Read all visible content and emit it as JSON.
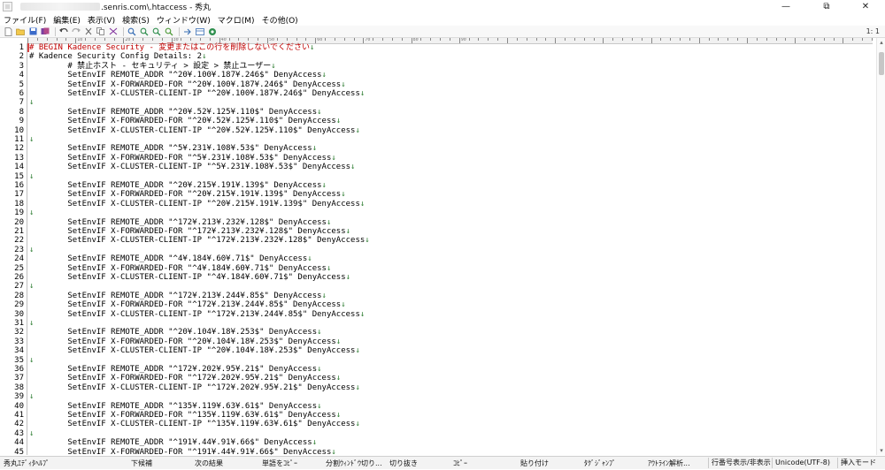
{
  "window": {
    "title_path": ".senris.com\\.htaccess - 秀丸",
    "controls": {
      "minimize": "—",
      "restore": "⧉",
      "close": "✕"
    }
  },
  "menu": [
    "ファイル(F)",
    "編集(E)",
    "表示(V)",
    "検索(S)",
    "ウィンドウ(W)",
    "マクロ(M)",
    "その他(O)"
  ],
  "toolbar": {
    "buttons": [
      "new-file-icon",
      "open-icon",
      "save-icon",
      "save-all-icon",
      "undo-icon",
      "redo-icon",
      "cut-icon",
      "copy-icon",
      "paste-icon",
      "search-icon",
      "find-next-icon",
      "find-prev-icon",
      "grep-icon",
      "jump-icon",
      "macro-icon",
      "record-icon"
    ],
    "zoom": "1: 1"
  },
  "ruler": {
    "labels": [
      "10",
      "20",
      "30",
      "40",
      "50",
      "60",
      "70",
      "80",
      "90"
    ]
  },
  "editor": {
    "eol_mark": "↓",
    "lines": [
      {
        "n": "1",
        "t": "# BEGIN Kadence Security - 変更またはこの行を削除しないでください",
        "kind": "comment-red"
      },
      {
        "n": "2",
        "t": "# Kadence Security Config Details: 2",
        "kind": "comment"
      },
      {
        "n": "3",
        "t": "        # 禁止ホスト - セキュリティ > 設定 > 禁止ユーザー",
        "kind": "comment"
      },
      {
        "n": "4",
        "t": "        SetEnvIF REMOTE_ADDR \"^20¥.100¥.187¥.246$\" DenyAccess",
        "kind": "code"
      },
      {
        "n": "5",
        "t": "        SetEnvIF X-FORWARDED-FOR \"^20¥.100¥.187¥.246$\" DenyAccess",
        "kind": "code"
      },
      {
        "n": "6",
        "t": "        SetEnvIF X-CLUSTER-CLIENT-IP \"^20¥.100¥.187¥.246$\" DenyAccess",
        "kind": "code"
      },
      {
        "n": "7",
        "t": "",
        "kind": "code"
      },
      {
        "n": "8",
        "t": "        SetEnvIF REMOTE_ADDR \"^20¥.52¥.125¥.110$\" DenyAccess",
        "kind": "code"
      },
      {
        "n": "9",
        "t": "        SetEnvIF X-FORWARDED-FOR \"^20¥.52¥.125¥.110$\" DenyAccess",
        "kind": "code"
      },
      {
        "n": "10",
        "t": "        SetEnvIF X-CLUSTER-CLIENT-IP \"^20¥.52¥.125¥.110$\" DenyAccess",
        "kind": "code"
      },
      {
        "n": "11",
        "t": "",
        "kind": "code"
      },
      {
        "n": "12",
        "t": "        SetEnvIF REMOTE_ADDR \"^5¥.231¥.108¥.53$\" DenyAccess",
        "kind": "code"
      },
      {
        "n": "13",
        "t": "        SetEnvIF X-FORWARDED-FOR \"^5¥.231¥.108¥.53$\" DenyAccess",
        "kind": "code"
      },
      {
        "n": "14",
        "t": "        SetEnvIF X-CLUSTER-CLIENT-IP \"^5¥.231¥.108¥.53$\" DenyAccess",
        "kind": "code"
      },
      {
        "n": "15",
        "t": "",
        "kind": "code"
      },
      {
        "n": "16",
        "t": "        SetEnvIF REMOTE_ADDR \"^20¥.215¥.191¥.139$\" DenyAccess",
        "kind": "code"
      },
      {
        "n": "17",
        "t": "        SetEnvIF X-FORWARDED-FOR \"^20¥.215¥.191¥.139$\" DenyAccess",
        "kind": "code"
      },
      {
        "n": "18",
        "t": "        SetEnvIF X-CLUSTER-CLIENT-IP \"^20¥.215¥.191¥.139$\" DenyAccess",
        "kind": "code"
      },
      {
        "n": "19",
        "t": "",
        "kind": "code"
      },
      {
        "n": "20",
        "t": "        SetEnvIF REMOTE_ADDR \"^172¥.213¥.232¥.128$\" DenyAccess",
        "kind": "code"
      },
      {
        "n": "21",
        "t": "        SetEnvIF X-FORWARDED-FOR \"^172¥.213¥.232¥.128$\" DenyAccess",
        "kind": "code"
      },
      {
        "n": "22",
        "t": "        SetEnvIF X-CLUSTER-CLIENT-IP \"^172¥.213¥.232¥.128$\" DenyAccess",
        "kind": "code"
      },
      {
        "n": "23",
        "t": "",
        "kind": "code"
      },
      {
        "n": "24",
        "t": "        SetEnvIF REMOTE_ADDR \"^4¥.184¥.60¥.71$\" DenyAccess",
        "kind": "code"
      },
      {
        "n": "25",
        "t": "        SetEnvIF X-FORWARDED-FOR \"^4¥.184¥.60¥.71$\" DenyAccess",
        "kind": "code"
      },
      {
        "n": "26",
        "t": "        SetEnvIF X-CLUSTER-CLIENT-IP \"^4¥.184¥.60¥.71$\" DenyAccess",
        "kind": "code"
      },
      {
        "n": "27",
        "t": "",
        "kind": "code"
      },
      {
        "n": "28",
        "t": "        SetEnvIF REMOTE_ADDR \"^172¥.213¥.244¥.85$\" DenyAccess",
        "kind": "code"
      },
      {
        "n": "29",
        "t": "        SetEnvIF X-FORWARDED-FOR \"^172¥.213¥.244¥.85$\" DenyAccess",
        "kind": "code"
      },
      {
        "n": "30",
        "t": "        SetEnvIF X-CLUSTER-CLIENT-IP \"^172¥.213¥.244¥.85$\" DenyAccess",
        "kind": "code"
      },
      {
        "n": "31",
        "t": "",
        "kind": "code"
      },
      {
        "n": "32",
        "t": "        SetEnvIF REMOTE_ADDR \"^20¥.104¥.18¥.253$\" DenyAccess",
        "kind": "code"
      },
      {
        "n": "33",
        "t": "        SetEnvIF X-FORWARDED-FOR \"^20¥.104¥.18¥.253$\" DenyAccess",
        "kind": "code"
      },
      {
        "n": "34",
        "t": "        SetEnvIF X-CLUSTER-CLIENT-IP \"^20¥.104¥.18¥.253$\" DenyAccess",
        "kind": "code"
      },
      {
        "n": "35",
        "t": "",
        "kind": "code"
      },
      {
        "n": "36",
        "t": "        SetEnvIF REMOTE_ADDR \"^172¥.202¥.95¥.21$\" DenyAccess",
        "kind": "code"
      },
      {
        "n": "37",
        "t": "        SetEnvIF X-FORWARDED-FOR \"^172¥.202¥.95¥.21$\" DenyAccess",
        "kind": "code"
      },
      {
        "n": "38",
        "t": "        SetEnvIF X-CLUSTER-CLIENT-IP \"^172¥.202¥.95¥.21$\" DenyAccess",
        "kind": "code"
      },
      {
        "n": "39",
        "t": "",
        "kind": "code"
      },
      {
        "n": "40",
        "t": "        SetEnvIF REMOTE_ADDR \"^135¥.119¥.63¥.61$\" DenyAccess",
        "kind": "code"
      },
      {
        "n": "41",
        "t": "        SetEnvIF X-FORWARDED-FOR \"^135¥.119¥.63¥.61$\" DenyAccess",
        "kind": "code"
      },
      {
        "n": "42",
        "t": "        SetEnvIF X-CLUSTER-CLIENT-IP \"^135¥.119¥.63¥.61$\" DenyAccess",
        "kind": "code"
      },
      {
        "n": "43",
        "t": "",
        "kind": "code"
      },
      {
        "n": "44",
        "t": "        SetEnvIF REMOTE_ADDR \"^191¥.44¥.91¥.66$\" DenyAccess",
        "kind": "code"
      },
      {
        "n": "45",
        "t": "        SetEnvIF X-FORWARDED-FOR \"^191¥.44¥.91¥.66$\" DenyAccess",
        "kind": "code"
      }
    ]
  },
  "statusbar": {
    "fkeys": [
      "秀丸ｴﾃﾞｨﾀﾍﾙﾌﾟ",
      "下候補",
      "次の結果",
      "単語をｺﾋﾟｰ",
      "分割ｳｨﾝﾄﾞｳ切り...",
      "切り抜き",
      "ｺﾋﾟｰ",
      "貼り付け",
      "ﾀｸﾞｼﾞｬﾝﾌﾟ",
      "ｱｳﾄﾗｲﾝ解析..."
    ],
    "line_num_toggle": "行番号表示/非表示",
    "encoding": "Unicode(UTF-8)",
    "mode": "挿入モード"
  }
}
